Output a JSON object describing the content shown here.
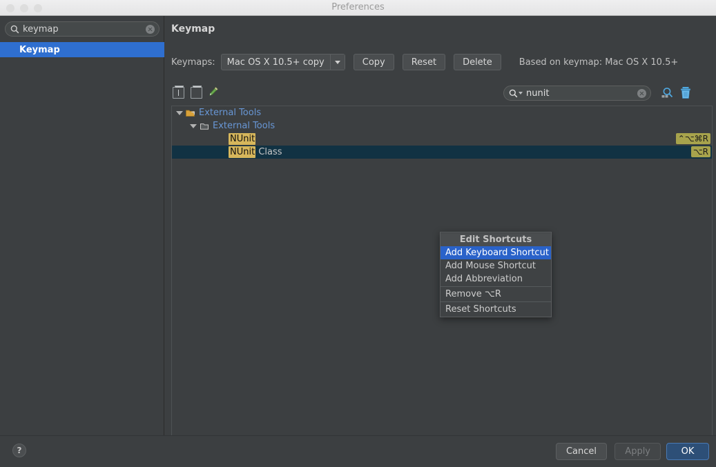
{
  "window": {
    "title": "Preferences",
    "traffic_lights": [
      "close-button",
      "minimize-button",
      "zoom-button"
    ]
  },
  "sidebar": {
    "search": {
      "value": "keymap",
      "placeholder": "",
      "icon": "search-icon",
      "clear_icon": "clear-icon"
    },
    "items": [
      {
        "label": "Keymap",
        "selected": true
      }
    ]
  },
  "main": {
    "page_title": "Keymap",
    "keymaps": {
      "label": "Keymaps:",
      "selected": "Mac OS X 10.5+ copy",
      "options": [
        "Mac OS X 10.5+ copy"
      ],
      "copy_label": "Copy",
      "reset_label": "Reset",
      "delete_label": "Delete",
      "based_on": "Based on keymap: Mac OS X 10.5+"
    },
    "toolbar": {
      "expand_all": "expand-all-icon",
      "collapse_all": "collapse-all-icon",
      "edit": "edit-pencil-icon",
      "search": {
        "value": "nunit",
        "icon": "search-icon",
        "clear_icon": "clear-icon"
      },
      "find_by_shortcut": "find-by-shortcut-icon",
      "clear_filter": "trash-icon"
    },
    "tree": [
      {
        "id": "root",
        "label": "External Tools",
        "icon": "external-tools-folder-icon",
        "depth": 0,
        "expanded": true,
        "link": true,
        "shortcut": "",
        "selected": false,
        "highlight": ""
      },
      {
        "id": "group",
        "label": "External Tools",
        "icon": "folder-icon",
        "depth": 1,
        "expanded": true,
        "link": true,
        "shortcut": "",
        "selected": false,
        "highlight": ""
      },
      {
        "id": "nunit",
        "label": "NUnit",
        "icon": "",
        "depth": 2,
        "expanded": null,
        "link": false,
        "shortcut": "⌃⌥⌘R",
        "selected": false,
        "highlight": "NUnit"
      },
      {
        "id": "nunit-class",
        "label": "NUnit Class",
        "icon": "",
        "depth": 2,
        "expanded": null,
        "link": false,
        "shortcut": "⌥R",
        "selected": true,
        "highlight": "NUnit"
      }
    ]
  },
  "context_menu": {
    "title": "Edit Shortcuts",
    "items": [
      {
        "label": "Add Keyboard Shortcut",
        "active": true,
        "separator_before": false
      },
      {
        "label": "Add Mouse Shortcut",
        "active": false,
        "separator_before": false
      },
      {
        "label": "Add Abbreviation",
        "active": false,
        "separator_before": false
      },
      {
        "label": "Remove ⌥R",
        "active": false,
        "separator_before": true
      },
      {
        "label": "Reset Shortcuts",
        "active": false,
        "separator_before": true
      }
    ]
  },
  "footer": {
    "help": "?",
    "cancel_label": "Cancel",
    "apply_label": "Apply",
    "apply_enabled": false,
    "ok_label": "OK"
  },
  "colors": {
    "window_bg": "#3c3f41",
    "sidebar_selection": "#2f6fd0",
    "tree_selection": "#113243",
    "search_highlight": "#d6b65b",
    "shortcut_badge": "#a7a34c",
    "menu_active": "#2a62c9",
    "link_text": "#6897d6",
    "ok_button": "#2d4f77"
  }
}
